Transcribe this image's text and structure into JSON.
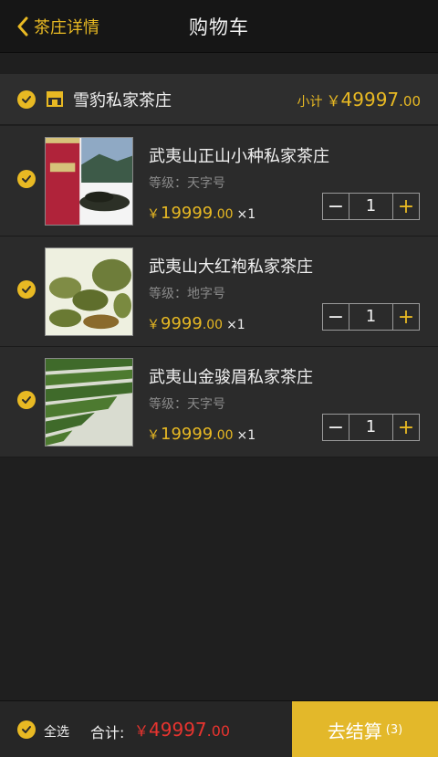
{
  "header": {
    "back_label": "茶庄详情",
    "title": "购物车"
  },
  "shop": {
    "name": "雪豹私家茶庄",
    "subtotal_label": "小计",
    "subtotal_currency": "￥",
    "subtotal_int": "49997",
    "subtotal_dec": ".00"
  },
  "items": [
    {
      "name": "武夷山正山小种私家茶庄",
      "grade": "等级：天字号",
      "currency": "￥",
      "price_int": "19999",
      "price_dec": ".00",
      "qty_text": "×1",
      "quantity": "1",
      "image": "red-tea-can-image"
    },
    {
      "name": "武夷山大红袍私家茶庄",
      "grade": "等级：地字号",
      "currency": "￥",
      "price_int": "9999",
      "price_dec": ".00",
      "qty_text": "×1",
      "quantity": "1",
      "image": "tea-cups-image"
    },
    {
      "name": "武夷山金骏眉私家茶庄",
      "grade": "等级：天字号",
      "currency": "￥",
      "price_int": "19999",
      "price_dec": ".00",
      "qty_text": "×1",
      "quantity": "1",
      "image": "tea-field-image"
    }
  ],
  "stepper": {
    "minus": "−",
    "plus": "+"
  },
  "footer": {
    "select_all_label": "全选",
    "total_label": "合计:",
    "total_currency": "￥",
    "total_int": "49997",
    "total_dec": ".00",
    "checkout_label": "去结算",
    "checkout_count": "(3)"
  },
  "colors": {
    "accent": "#e8b923",
    "price_red": "#e8342f",
    "background": "#1f1f1f",
    "card": "#2b2b2b"
  }
}
